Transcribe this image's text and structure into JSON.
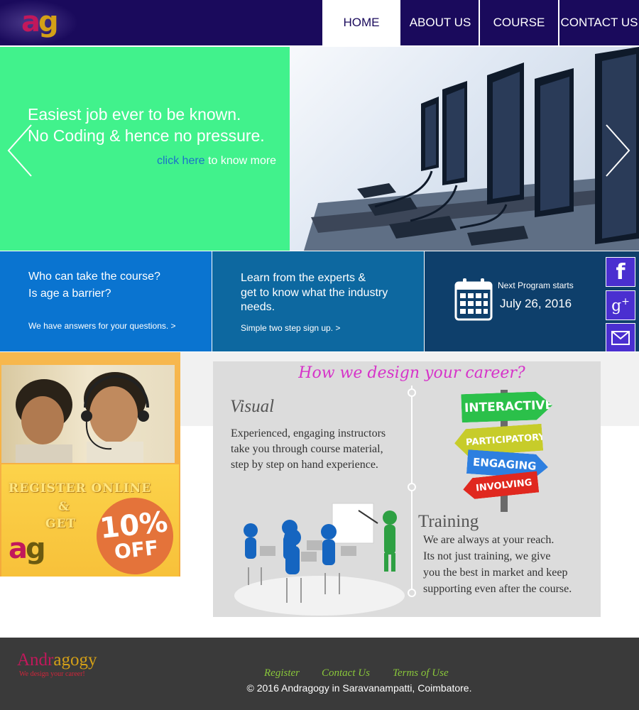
{
  "header": {
    "logo": "ag",
    "nav": [
      "HOME",
      "ABOUT US",
      "COURSE",
      "CONTACT US"
    ],
    "active": "HOME",
    "colors": {
      "bar": "#1a0a5c",
      "active_bg": "#ffffff"
    }
  },
  "hero": {
    "line1": "Easiest job ever to be known.",
    "line2": "No Coding & hence no pressure.",
    "link_text": "click here",
    "link_rest": "to know more",
    "prev_icon": "chevron-left-icon",
    "next_icon": "chevron-right-icon",
    "colors": {
      "panel": "#41f28c",
      "link": "#1b72c9"
    }
  },
  "info": {
    "box1": {
      "line1": "Who can take the course?",
      "line2": "Is age a barrier?",
      "small": "We have answers for your questions. >"
    },
    "box2": {
      "line1": "Learn from the experts &",
      "line2": "get to know what the industry",
      "line3": "needs.",
      "small": "Simple two step sign up. >"
    },
    "box3": {
      "caption": "Next Program starts",
      "date": "July 26, 2016",
      "icon": "calendar-icon"
    }
  },
  "social": {
    "icons": [
      "facebook-icon",
      "google-plus-icon",
      "email-icon",
      "twitter-icon"
    ]
  },
  "promo": {
    "register_line1": "REGISTER ONLINE",
    "register_line2": "&",
    "register_line3": "GET",
    "discount": "10%",
    "off": "OFF",
    "logo": "ag"
  },
  "career": {
    "title": "How we design your career?",
    "visual": {
      "heading": "Visual",
      "line1": "Experienced, engaging instructors",
      "line2": "take you through course material,",
      "line3": "step by step on hand experience."
    },
    "signs": [
      "INTERACTIVE",
      "PARTICIPATORY",
      "ENGAGING",
      "INVOLVING"
    ],
    "training": {
      "heading": "Training",
      "line1": "We are always at your reach.",
      "line2": "Its not just training, we give",
      "line3": "you the best in market and keep",
      "line4": "supporting even after the course."
    }
  },
  "footer": {
    "brand": "Andragogy",
    "tagline": "We design your career!",
    "links": [
      "Register",
      "Contact Us",
      "Terms of Use"
    ],
    "copyright": "© 2016 Andragogy in Saravanampatti, Coimbatore."
  }
}
